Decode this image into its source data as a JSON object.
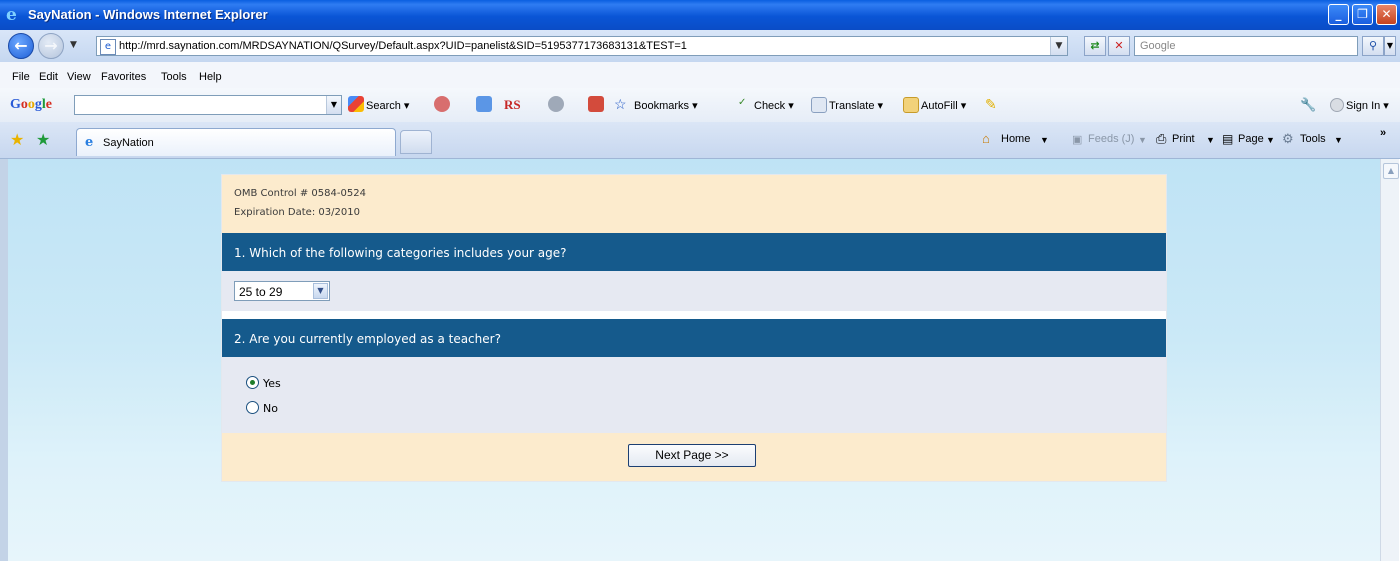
{
  "window": {
    "title": "SayNation - Windows Internet Explorer",
    "minimize": "_",
    "restore": "❐",
    "close": "✕"
  },
  "address": {
    "url": "http://mrd.saynation.com/MRDSAYNATION/QSurvey/Default.aspx?UID=panelist&SID=5195377173683131&TEST=1",
    "search_placeholder": "Google"
  },
  "menu": [
    "File",
    "Edit",
    "View",
    "Favorites",
    "Tools",
    "Help"
  ],
  "google_toolbar": {
    "logo": "Google",
    "search": "Search ▾",
    "bookmarks": "Bookmarks ▾",
    "check": "Check ▾",
    "translate": "Translate ▾",
    "autofill": "AutoFill ▾",
    "signin": "Sign In ▾",
    "rs": "RS"
  },
  "tabs": [
    {
      "label": "SayNation"
    }
  ],
  "commands": {
    "home": "Home",
    "feeds": "Feeds (J)",
    "print": "Print",
    "page": "Page",
    "tools": "Tools",
    "more": "»"
  },
  "survey": {
    "omb": "OMB Control # 0584-0524",
    "expiration": "Expiration Date: 03/2010",
    "q1": "1.  Which of the following categories includes your age?",
    "q1_selected": "25 to 29",
    "q2": "2.  Are you currently employed as a teacher?",
    "q2_options": [
      "Yes",
      "No"
    ],
    "q2_selected": "Yes",
    "next_button": "Next Page >>"
  },
  "colors": {
    "question_bar": "#155a8c",
    "header_bg": "#fcebcd",
    "answer_bg": "#e6e9f2"
  }
}
